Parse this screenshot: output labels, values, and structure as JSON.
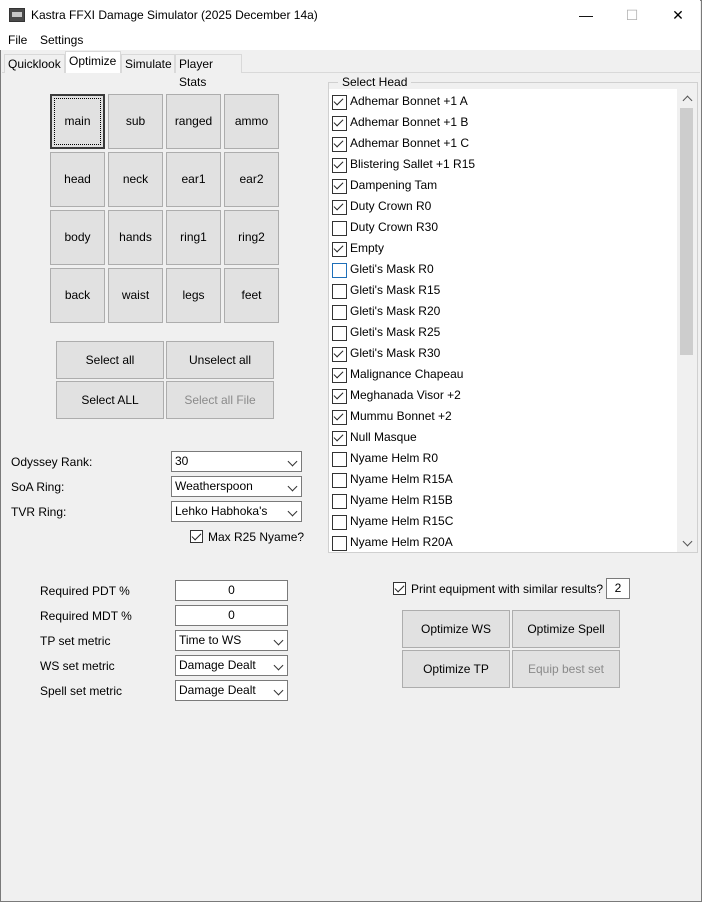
{
  "window": {
    "title": "Kastra FFXI Damage Simulator  (2025 December 14a)",
    "minimize": "—",
    "maximize": "☐",
    "close": "✕"
  },
  "menu": [
    "File",
    "Settings"
  ],
  "tabs": [
    "Quicklook",
    "Optimize",
    "Simulate",
    "Player Stats"
  ],
  "active_tab": "Optimize",
  "slots": [
    [
      "main",
      "sub",
      "ranged",
      "ammo"
    ],
    [
      "head",
      "neck",
      "ear1",
      "ear2"
    ],
    [
      "body",
      "hands",
      "ring1",
      "ring2"
    ],
    [
      "back",
      "waist",
      "legs",
      "feet"
    ]
  ],
  "selection_buttons": {
    "select_all": "Select all",
    "unselect_all": "Unselect all",
    "select_ALL": "Select ALL",
    "select_all_file": "Select all File"
  },
  "settings": {
    "odyssey_rank_label": "Odyssey Rank:",
    "odyssey_rank_value": "30",
    "soa_ring_label": "SoA Ring:",
    "soa_ring_value": "Weatherspoon",
    "tvr_ring_label": "TVR Ring:",
    "tvr_ring_value": "Lehko Habhoka's",
    "max_r25_label": "Max R25 Nyame?"
  },
  "requirements": {
    "pdt_label": "Required PDT %",
    "pdt_value": "0",
    "mdt_label": "Required MDT %",
    "mdt_value": "0",
    "tp_metric_label": "TP set metric",
    "tp_metric_value": "Time to WS",
    "ws_metric_label": "WS set metric",
    "ws_metric_value": "Damage Dealt",
    "spell_metric_label": "Spell set metric",
    "spell_metric_value": "Damage Dealt"
  },
  "head_list": {
    "title": "Select Head",
    "items": [
      {
        "label": "Adhemar Bonnet +1 A",
        "checked": true
      },
      {
        "label": "Adhemar Bonnet +1 B",
        "checked": true
      },
      {
        "label": "Adhemar Bonnet +1 C",
        "checked": true
      },
      {
        "label": "Blistering Sallet +1 R15",
        "checked": true
      },
      {
        "label": "Dampening Tam",
        "checked": true
      },
      {
        "label": "Duty Crown R0",
        "checked": true
      },
      {
        "label": "Duty Crown R30",
        "checked": false
      },
      {
        "label": "Empty",
        "checked": true
      },
      {
        "label": "Gleti's Mask R0",
        "checked": false
      },
      {
        "label": "Gleti's Mask R15",
        "checked": false
      },
      {
        "label": "Gleti's Mask R20",
        "checked": false
      },
      {
        "label": "Gleti's Mask R25",
        "checked": false
      },
      {
        "label": "Gleti's Mask R30",
        "checked": true
      },
      {
        "label": "Malignance Chapeau",
        "checked": true
      },
      {
        "label": "Meghanada Visor +2",
        "checked": true
      },
      {
        "label": "Mummu Bonnet +2",
        "checked": true
      },
      {
        "label": "Null Masque",
        "checked": true
      },
      {
        "label": "Nyame Helm R0",
        "checked": false
      },
      {
        "label": "Nyame Helm R15A",
        "checked": false
      },
      {
        "label": "Nyame Helm R15B",
        "checked": false
      },
      {
        "label": "Nyame Helm R15C",
        "checked": false
      },
      {
        "label": "Nyame Helm R20A",
        "checked": false
      }
    ]
  },
  "print_similar": {
    "label": "Print equipment with similar results?",
    "value": "2"
  },
  "actions": {
    "optimize_ws": "Optimize WS",
    "optimize_spell": "Optimize Spell",
    "optimize_tp": "Optimize TP",
    "equip_best_set": "Equip best set"
  }
}
